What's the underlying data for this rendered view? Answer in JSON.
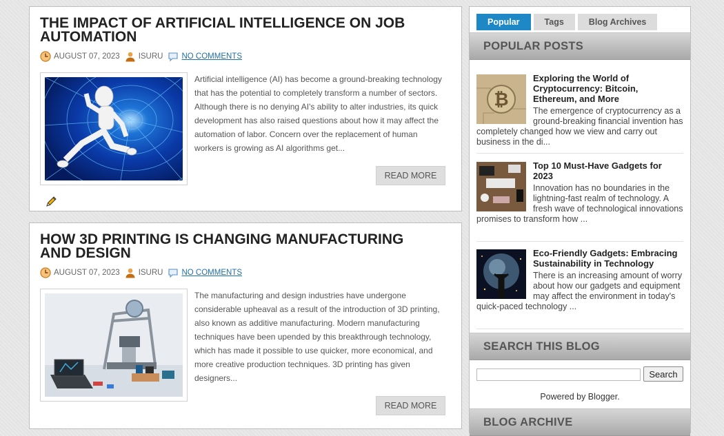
{
  "posts": [
    {
      "title": "THE IMPACT OF ARTIFICIAL INTELLIGENCE ON JOB AUTOMATION",
      "date": "AUGUST 07, 2023",
      "author": "ISURU",
      "comments": "NO COMMENTS",
      "excerpt": "Artificial intelligence (AI) has become a ground-breaking technology that has the potential to completely transform a number of sectors. Although there is no denying AI's ability to alter industries, its quick development has also raised questions about how it may affect the automation of labor. Concern over the replacement of human workers is growing as AI algorithms get...",
      "read_more": "READ MORE"
    },
    {
      "title": "HOW 3D PRINTING IS CHANGING MANUFACTURING AND DESIGN",
      "date": "AUGUST 07, 2023",
      "author": "ISURU",
      "comments": "NO COMMENTS",
      "excerpt": "The manufacturing and design industries have undergone considerable upheaval as a result of the introduction of 3D printing, also known as additive manufacturing. Modern manufacturing techniques have been upended by this breakthrough technology, which has made it possible to use quicker, more economical, and more creative production techniques. 3D printing has given designers...",
      "read_more": "READ MORE"
    }
  ],
  "sidebar": {
    "tabs": [
      "Popular",
      "Tags",
      "Blog Archives"
    ],
    "popular_posts_heading": "POPULAR POSTS",
    "popular_posts": [
      {
        "title": "Exploring the World of Cryptocurrency: Bitcoin, Ethereum, and More",
        "snippet": "The emergence of cryptocurrency as a ground-breaking financial invention has completely changed how we view and carry out business in the di..."
      },
      {
        "title": "Top 10 Must-Have Gadgets for 2023",
        "snippet": "Innovation has no boundaries in the lightning-fast realm of technology. A fresh wave of technological innovations promises to transform how ..."
      },
      {
        "title": "Eco-Friendly Gadgets: Embracing Sustainability in Technology",
        "snippet": "There is an increasing amount of worry about how our gadgets and equipment may affect the environment in today's quick-paced technology ..."
      }
    ],
    "search_heading": "SEARCH THIS BLOG",
    "search_placeholder": "",
    "search_button": "Search",
    "powered_by": "Powered by Blogger.",
    "archive_heading": "BLOG ARCHIVE"
  },
  "colors": {
    "accent": "#1e88c7",
    "link": "#1f6fa8",
    "meta_icon": "#e8962e"
  }
}
